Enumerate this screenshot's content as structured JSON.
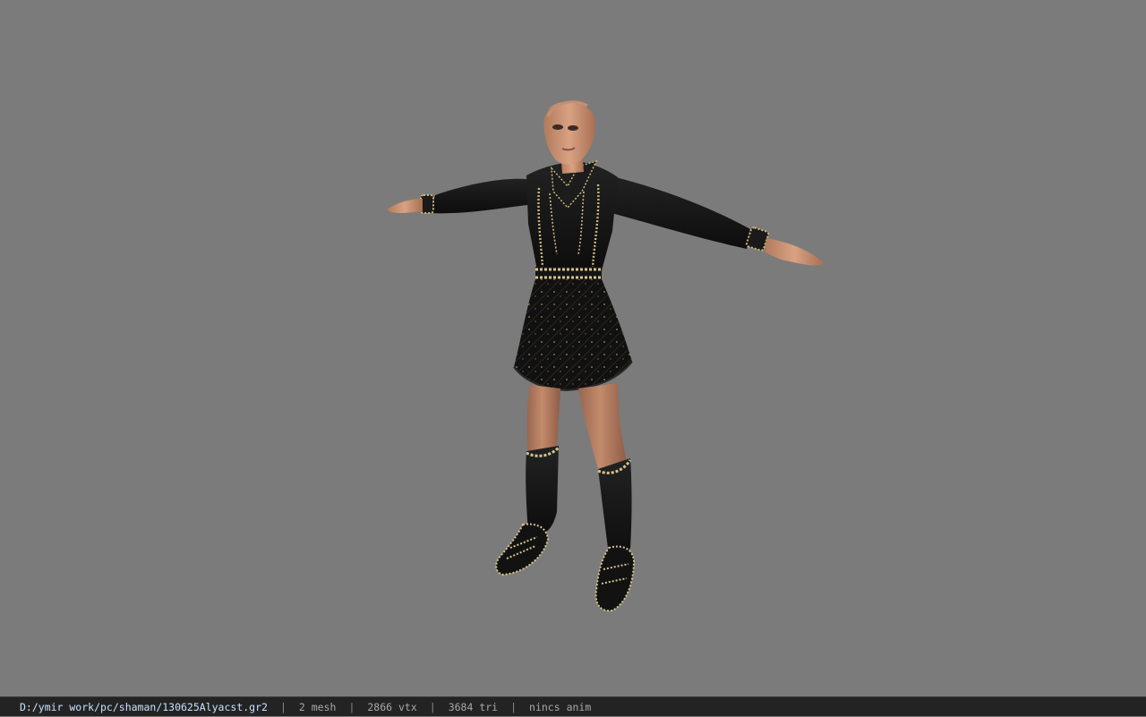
{
  "status_bar": {
    "file_path": "D:/ymir work/pc/shaman/130625Alyacst.gr2",
    "separator": "|",
    "mesh_count": "2 mesh",
    "vertex_count": "2866 vtx",
    "triangle_count": "3684 tri",
    "animation": "nincs anim"
  },
  "colors": {
    "viewport_background": "#7b7b7b",
    "statusbar_background": "#232323",
    "path_text": "#c7e3ff",
    "status_text": "#a8a8a8",
    "outfit_black": "#141414",
    "trim_gold": "#d8c38a",
    "skin": "#c99272"
  }
}
